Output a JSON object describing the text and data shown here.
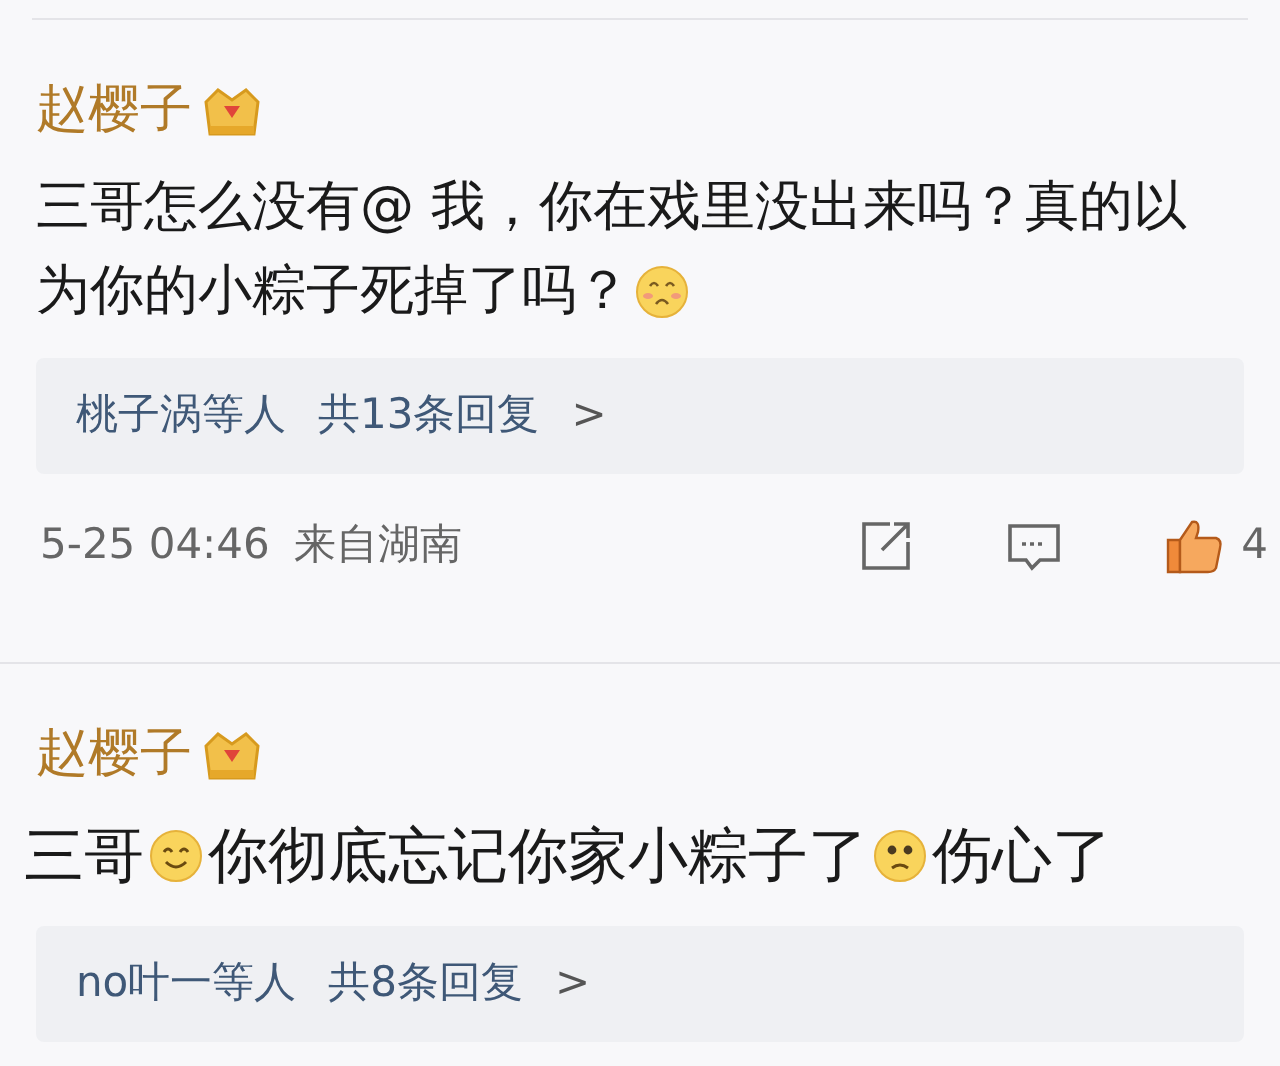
{
  "comments": [
    {
      "author": "赵樱子",
      "text_parts": [
        "三哥怎么没有@ 我，你在戏里没出来吗？真的以",
        "为你的小粽子死掉了吗？"
      ],
      "replies": {
        "users": "桃子涡等人",
        "count": "共13条回复",
        "arrow": ">"
      },
      "time": "5-25 04:46",
      "location": "来自湖南",
      "likes": "4"
    },
    {
      "author": "赵樱子",
      "text_parts": [
        "三哥",
        "你彻底忘记你家小粽子了",
        "伤心了"
      ],
      "replies": {
        "users": "no叶一等人",
        "count": "共8条回复",
        "arrow": ">"
      }
    }
  ]
}
